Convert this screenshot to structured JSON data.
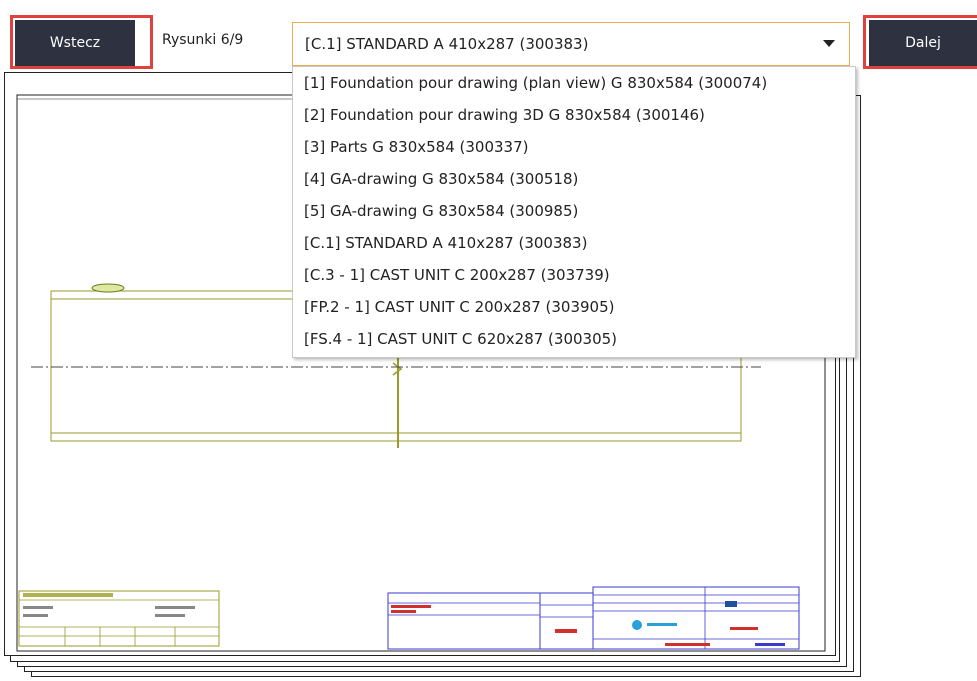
{
  "nav": {
    "back_label": "Wstecz",
    "next_label": "Dalej",
    "counter": "Rysunki 6/9"
  },
  "drawing_select": {
    "selected": "[C.1] STANDARD A 410x287 (300383)",
    "options": [
      "[1] Foundation pour drawing (plan view) G 830x584 (300074)",
      "[2] Foundation pour drawing 3D G 830x584 (300146)",
      "[3] Parts G 830x584 (300337)",
      "[4] GA-drawing G 830x584 (300518)",
      "[5] GA-drawing G 830x584 (300985)",
      "[C.1] STANDARD A 410x287 (300383)",
      "[C.3 - 1] CAST UNIT C 200x287 (303739)",
      "[FP.2 - 1] CAST UNIT C 200x287 (303905)",
      "[FS.4 - 1] CAST UNIT C 620x287 (300305)"
    ]
  },
  "colors": {
    "button_bg": "#2d3140",
    "highlight": "#e0413c",
    "select_border": "#e8b04a",
    "drawing_line": "#9a9a2a"
  },
  "icons": {
    "caret": "chevron-down-icon"
  }
}
